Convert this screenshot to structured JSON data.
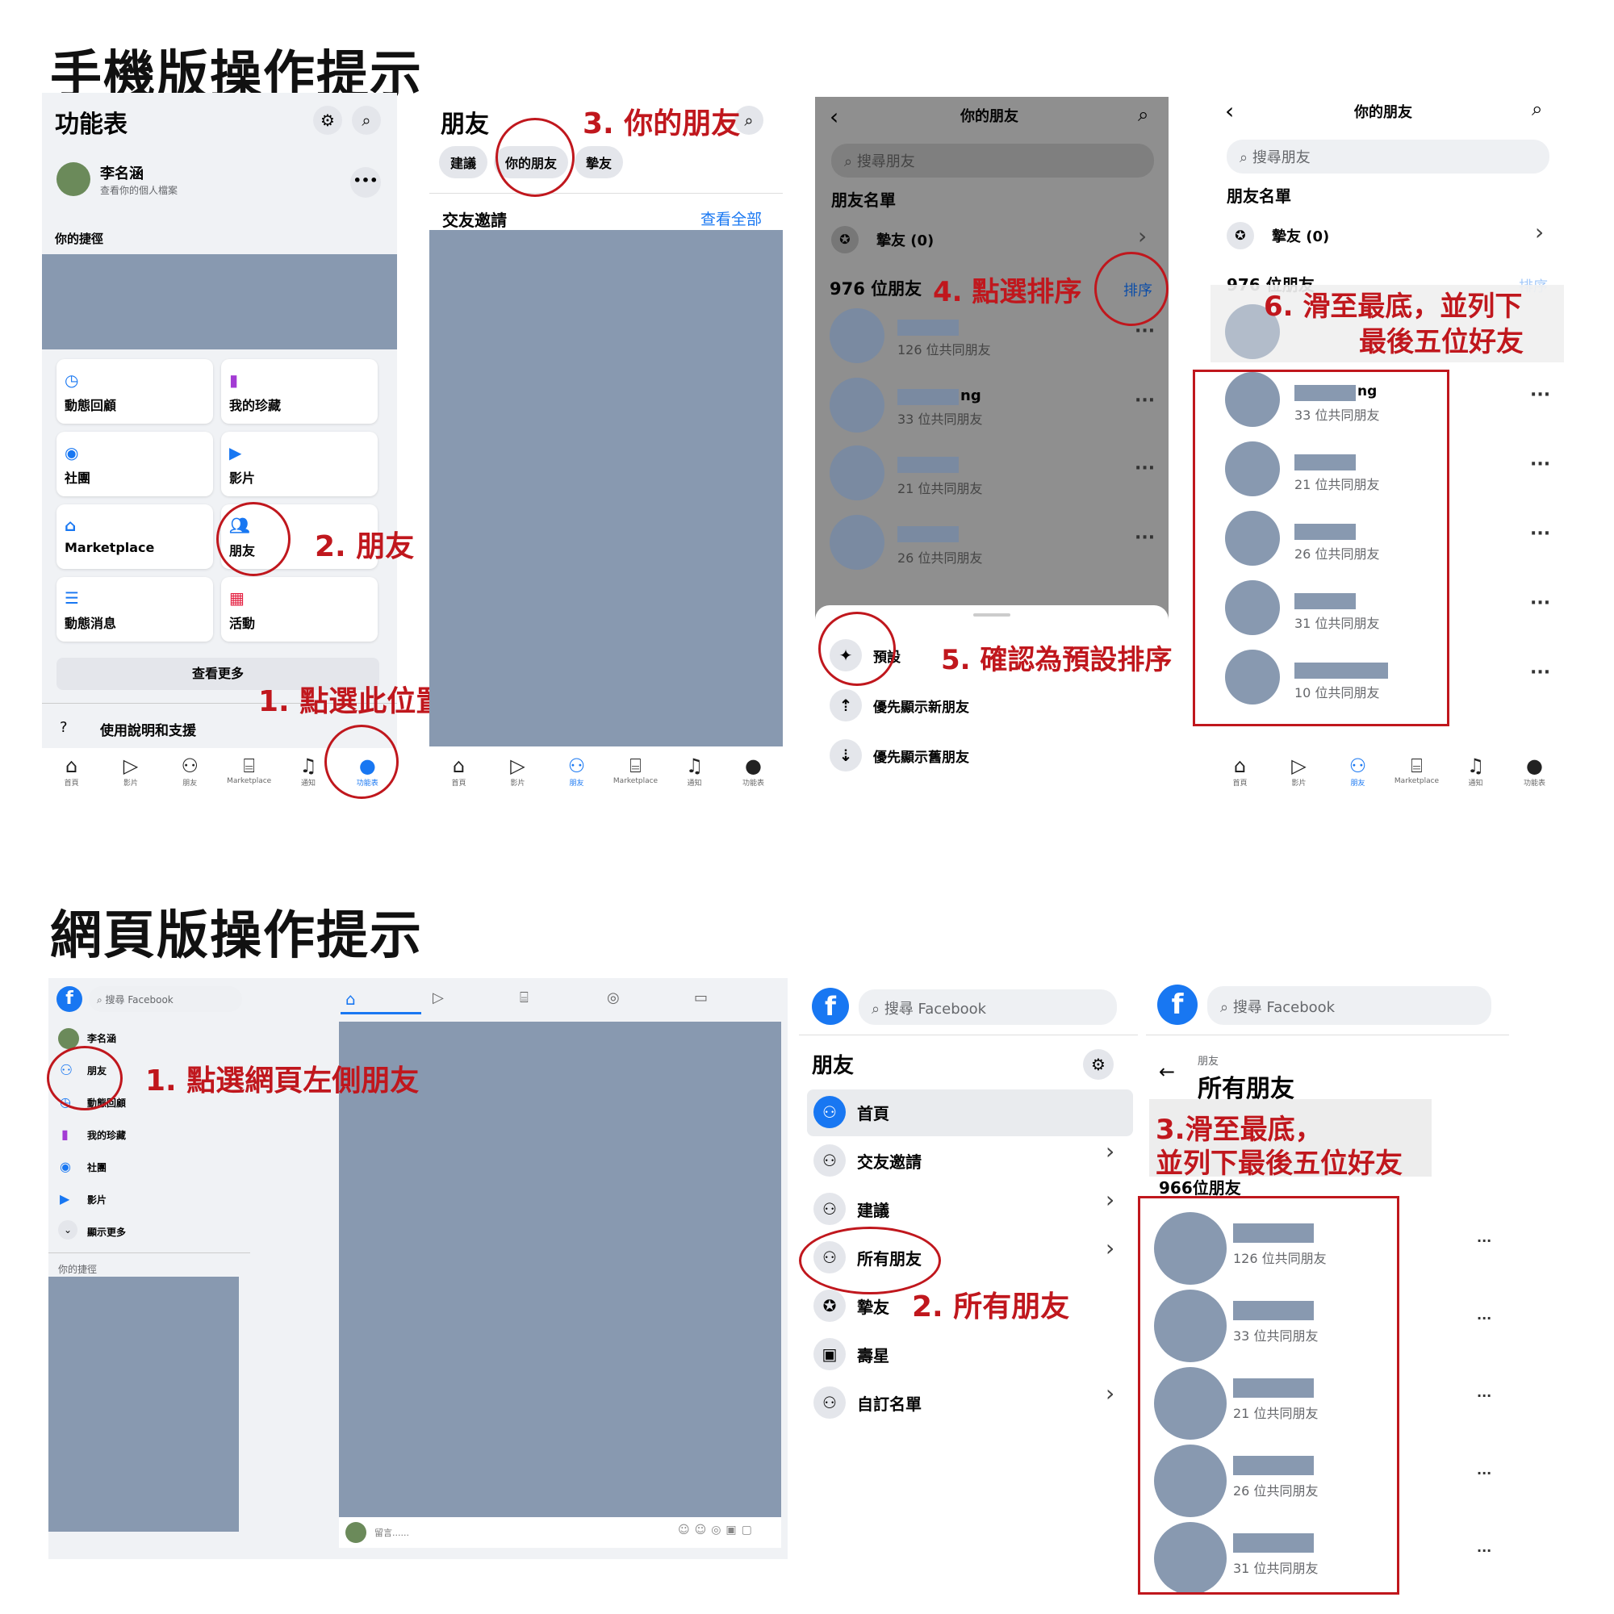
{
  "mobile_title": "手機版操作提示",
  "web_title": "網頁版操作提示",
  "steps_mobile": [
    "1. 點選此位置",
    "2. 朋友",
    "3. 你的朋友",
    "4. 點選排序",
    "5. 確認為預設排序",
    "6. 滑至最底，並列下",
    "最後五位好友"
  ],
  "steps_web": [
    "1. 點選網頁左側朋友",
    "2. 所有朋友",
    "3.滑至最底，",
    "並列下最後五位好友"
  ],
  "menu": {
    "title": "功能表",
    "name": "李名涵",
    "profile_sub": "查看你的個人檔案",
    "shortcuts": "你的捷徑",
    "items": [
      "動態回顧",
      "我的珍藏",
      "社團",
      "影片",
      "Marketplace",
      "朋友",
      "動態消息",
      "活動"
    ],
    "see_more": "查看更多",
    "help": "使用說明和支援"
  },
  "tabs": [
    "首頁",
    "影片",
    "朋友",
    "Marketplace",
    "通知",
    "功能表"
  ],
  "friends_page": {
    "title": "朋友",
    "pills": [
      "建議",
      "你的朋友",
      "摯友"
    ],
    "requests": "交友邀請",
    "see_all": "查看全部"
  },
  "your_friends": {
    "title": "你的朋友",
    "search": "搜尋朋友",
    "list_title": "朋友名單",
    "close_friends": "摯友 (0)",
    "count": "976 位朋友",
    "sort": "排序",
    "mutuals": [
      "126 位共同朋友",
      "33 位共同朋友",
      "21 位共同朋友",
      "26 位共同朋友",
      "31 位共同朋友",
      "10 位共同朋友"
    ],
    "ng": "ng",
    "sort_options": [
      "預設",
      "優先顯示新朋友",
      "優先顯示舊朋友"
    ]
  },
  "web": {
    "search": "搜尋 Facebook",
    "left_items": [
      "李名涵",
      "朋友",
      "動態回顧",
      "我的珍藏",
      "社團",
      "影片",
      "顯示更多"
    ],
    "shortcuts": "你的捷徑",
    "comment": "留言......",
    "friends_title": "朋友",
    "nav": [
      "首頁",
      "交友邀請",
      "建議",
      "所有朋友",
      "摯友",
      "壽星",
      "自訂名單"
    ],
    "crumb": "朋友",
    "all_friends": "所有朋友",
    "count": "966位朋友",
    "mutuals": [
      "126 位共同朋友",
      "33 位共同朋友",
      "21 位共同朋友",
      "26 位共同朋友",
      "31 位共同朋友"
    ]
  },
  "colors": {
    "accent": "#c0171d",
    "fb": "#1877f2",
    "redact": "#8899b0"
  }
}
